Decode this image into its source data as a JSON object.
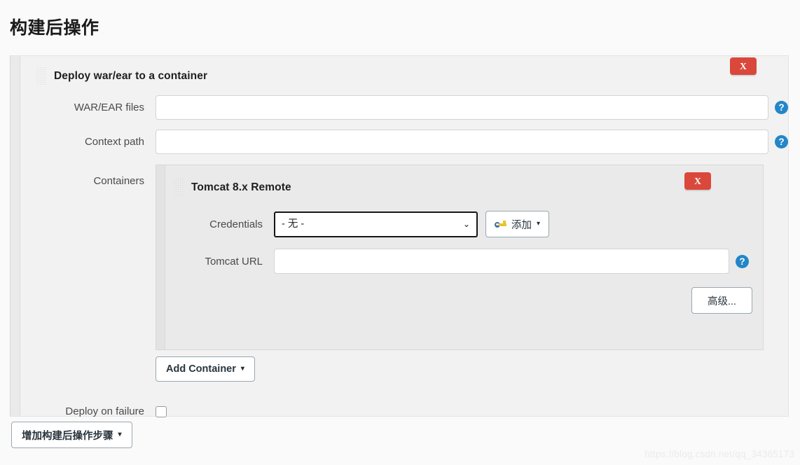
{
  "page": {
    "title": "构建后操作",
    "watermark": "https://blog.csdn.net/qq_34365173"
  },
  "colors": {
    "delete_red": "#d9483b",
    "help_blue": "#2386c8",
    "page_bg": "#fafafa",
    "panel_bg": "#f2f2f2",
    "nested_panel_bg": "#eaeaea",
    "button_border": "#9aa7b0"
  },
  "post_build": {
    "section_title": "Deploy war/ear to a container",
    "delete_label": "X",
    "fields": {
      "war_ear": {
        "label": "WAR/EAR files",
        "value": "",
        "placeholder": "",
        "help": "?"
      },
      "context_path": {
        "label": "Context path",
        "value": "",
        "placeholder": "",
        "help": "?"
      },
      "containers": {
        "label": "Containers"
      },
      "deploy_on_failure": {
        "label": "Deploy on failure",
        "checked": false
      }
    },
    "add_container_button": {
      "label": "Add Container",
      "caret": "▾"
    }
  },
  "container": {
    "section_title": "Tomcat 8.x Remote",
    "delete_label": "X",
    "credentials": {
      "label": "Credentials",
      "selected": "- 无 -",
      "options": [
        "- 无 -"
      ],
      "chevron": "⌄",
      "add_button": {
        "label": "添加",
        "caret": "▾",
        "icon": "key-icon"
      }
    },
    "tomcat_url": {
      "label": "Tomcat URL",
      "value": "",
      "placeholder": "",
      "help": "?"
    },
    "advanced_button": {
      "label": "高级..."
    }
  },
  "footer": {
    "add_post_build_step": {
      "label": "增加构建后操作步骤",
      "caret": "▾"
    }
  }
}
